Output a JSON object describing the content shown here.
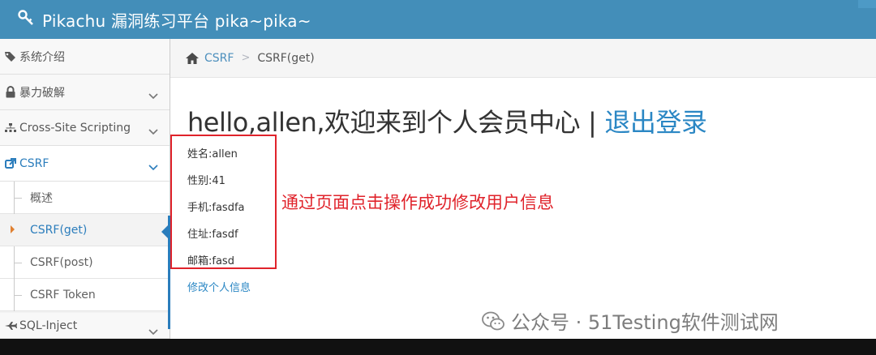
{
  "header": {
    "title": "Pikachu 漏洞练习平台 pika~pika~",
    "brand_icon": "key-icon",
    "bg_color": "#438eb9"
  },
  "sidebar": {
    "items": [
      {
        "label": "系统介绍",
        "icon": "tags-icon"
      },
      {
        "label": "暴力破解",
        "icon": "lock-icon"
      },
      {
        "label": "Cross-Site Scripting",
        "icon": "sitemap-icon"
      },
      {
        "label": "CSRF",
        "icon": "share-icon"
      },
      {
        "label": "SQL-Inject",
        "icon": "plane-icon"
      }
    ],
    "csrf_subitems": [
      {
        "label": "概述"
      },
      {
        "label": "CSRF(get)"
      },
      {
        "label": "CSRF(post)"
      },
      {
        "label": "CSRF Token"
      }
    ]
  },
  "breadcrumb": {
    "link": "CSRF",
    "current": "CSRF(get)"
  },
  "main": {
    "welcome_text": "hello,allen,欢迎来到个人会员中心",
    "divider": "|",
    "logout_label": "退出登录",
    "info": [
      "姓名:allen",
      "性别:41",
      "手机:fasdfa",
      "住址:fasdf",
      "邮箱:fasd"
    ],
    "edit_link": "修改个人信息",
    "annotation": "通过页面点击操作成功修改用户信息"
  },
  "watermark": {
    "text": "公众号 · 51Testing软件测试网"
  },
  "colors": {
    "accent": "#2b87c4",
    "annotation_red": "#e0232b"
  }
}
